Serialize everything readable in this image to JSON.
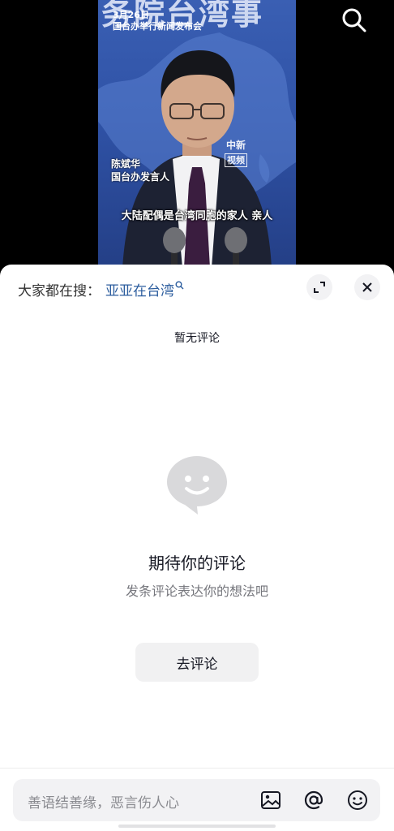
{
  "video": {
    "banner_text": "务院台湾事",
    "date": "3月26日",
    "event": "国台办举行新闻发布会",
    "watermark_line1": "中新",
    "watermark_line2": "视频",
    "speaker_name": "陈斌华",
    "speaker_title": "国台办发言人",
    "subtitle": "大陆配偶是台湾同胞的家人 亲人",
    "search_icon": "search-icon"
  },
  "comment_sheet": {
    "search_prefix": "大家都在搜：",
    "search_term": "亚亚在台湾",
    "no_comments": "暂无评论",
    "empty_title": "期待你的评论",
    "empty_subtitle": "发条评论表达你的想法吧",
    "go_comment_label": "去评论",
    "input_placeholder": "善语结善缘，恶言伤人心",
    "icons": [
      "expand-icon",
      "close-icon",
      "speech-bubble-smile-icon",
      "image-icon",
      "at-icon",
      "emoji-icon"
    ]
  },
  "colors": {
    "link": "#2c5d9e",
    "sheet_bg": "#ffffff",
    "video_bg": "#2f52a6"
  }
}
